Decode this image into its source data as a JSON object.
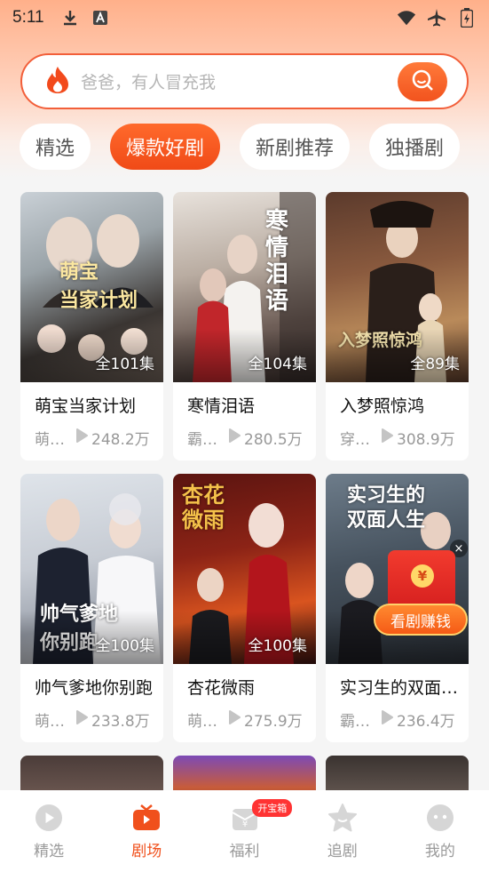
{
  "status_bar": {
    "time": "5:11"
  },
  "search": {
    "placeholder": "爸爸，有人冒充我"
  },
  "tabs": [
    {
      "label": "精选",
      "active": false
    },
    {
      "label": "爆款好剧",
      "active": true
    },
    {
      "label": "新剧推荐",
      "active": false
    },
    {
      "label": "独播剧",
      "active": false
    }
  ],
  "dramas": [
    {
      "title": "萌宝当家计划",
      "episodes": "全101集",
      "tag": "萌…",
      "views": "248.2万",
      "poster_text": "萌宝 当家计划"
    },
    {
      "title": "寒情泪语",
      "episodes": "全104集",
      "tag": "霸…",
      "views": "280.5万",
      "poster_text": "寒情泪语"
    },
    {
      "title": "入梦照惊鸿",
      "episodes": "全89集",
      "tag": "穿…",
      "views": "308.9万",
      "poster_text": "入梦照惊鸿"
    },
    {
      "title": "帅气爹地你别跑",
      "episodes": "全100集",
      "tag": "萌…",
      "views": "233.8万",
      "poster_text": "帅气爹地 你别跑"
    },
    {
      "title": "杏花微雨",
      "episodes": "全100集",
      "tag": "萌…",
      "views": "275.9万",
      "poster_text": "杏花微雨"
    },
    {
      "title": "实习生的双面…",
      "episodes": "",
      "tag": "霸…",
      "views": "236.4万",
      "poster_text": "实习生的 双面人生"
    }
  ],
  "promo": {
    "label": "看剧赚钱",
    "close": "×",
    "coin": "¥"
  },
  "bottom_nav": [
    {
      "label": "精选",
      "icon": "play-circle-icon",
      "active": false
    },
    {
      "label": "剧场",
      "icon": "tv-icon",
      "active": true
    },
    {
      "label": "福利",
      "icon": "gift-envelope-icon",
      "active": false,
      "badge": "开宝箱"
    },
    {
      "label": "追剧",
      "icon": "star-icon",
      "active": false
    },
    {
      "label": "我的",
      "icon": "face-icon",
      "active": false
    }
  ],
  "colors": {
    "accent": "#f0501c",
    "search_border": "#f25f3a"
  }
}
